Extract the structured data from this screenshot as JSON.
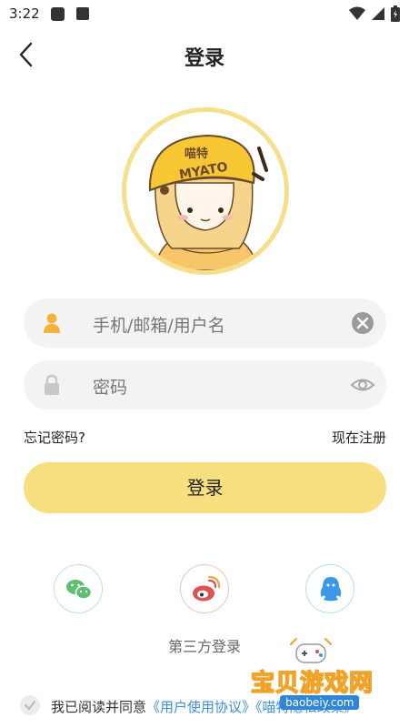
{
  "status_bar": {
    "time": "3:22"
  },
  "header": {
    "title": "登录"
  },
  "avatar": {
    "badge_text": "喵特",
    "helmet_text": "MYATO"
  },
  "form": {
    "username_placeholder": "手机/邮箱/用户名",
    "password_placeholder": "密码"
  },
  "links": {
    "forgot": "忘记密码?",
    "register": "现在注册"
  },
  "login_button": "登录",
  "third_party": {
    "label": "第三方登录",
    "providers": [
      "wechat",
      "weibo",
      "qq"
    ]
  },
  "agreement": {
    "prefix": "我已阅读并同意",
    "user_agreement": "《用户使用协议》",
    "privacy_policy": "《喵特隐私政策》"
  },
  "watermark": {
    "title": "宝贝游戏网",
    "url": "baobeiy.com"
  },
  "colors": {
    "accent": "#f7de7e",
    "avatar_ring": "#f6df8a",
    "link": "#3c8fe0",
    "wechat": "#5cbf72",
    "weibo": "#e0524f",
    "qq": "#3a99e8"
  }
}
